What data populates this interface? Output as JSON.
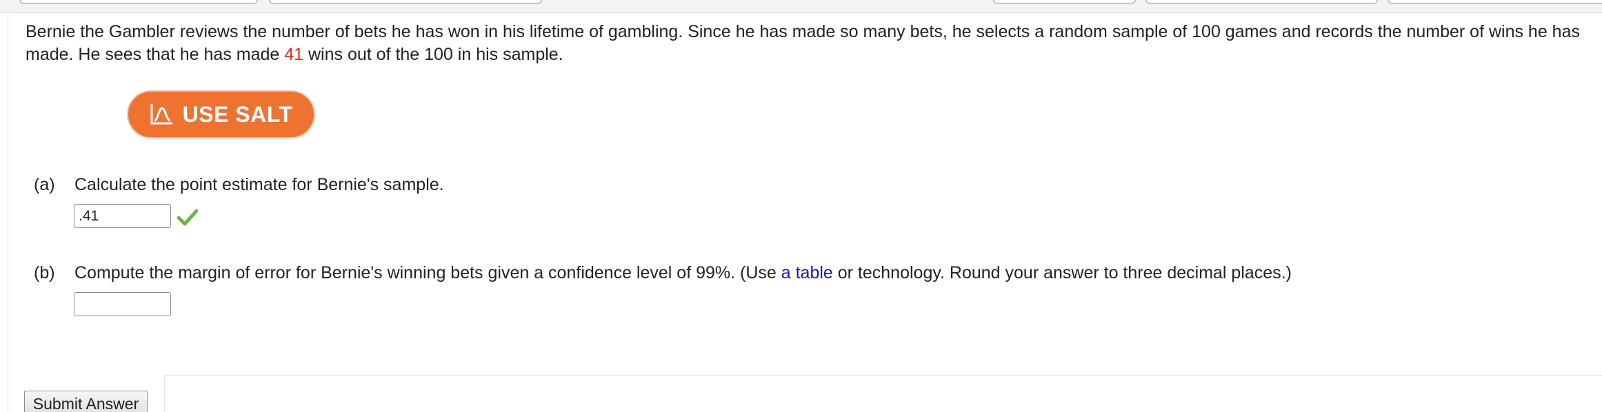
{
  "question": {
    "text_before": "Bernie the Gambler reviews the number of bets he has won in his lifetime of gambling. Since he has made so many bets, he selects a random sample of 100 games and records the number of wins he has made. He sees that he has made ",
    "wins_value": "41",
    "text_after": " wins out of the 100 in his sample."
  },
  "salt_button": {
    "label": "USE SALT",
    "icon": "salt-distribution-icon",
    "color": "#ef7330"
  },
  "part_a": {
    "label": "(a)",
    "prompt": "Calculate the point estimate for Bernie's sample.",
    "answer_value": ".41",
    "status_icon": "checkmark-icon",
    "status_color": "#6cb33f"
  },
  "part_b": {
    "label": "(b)",
    "prompt_before": "Compute the margin of error for Bernie's winning bets given a confidence level of 99%. (Use ",
    "link_text": "a table",
    "prompt_after": " or technology. Round your answer to three decimal places.)",
    "answer_value": ""
  },
  "submit_button": {
    "label": "Submit Answer"
  }
}
